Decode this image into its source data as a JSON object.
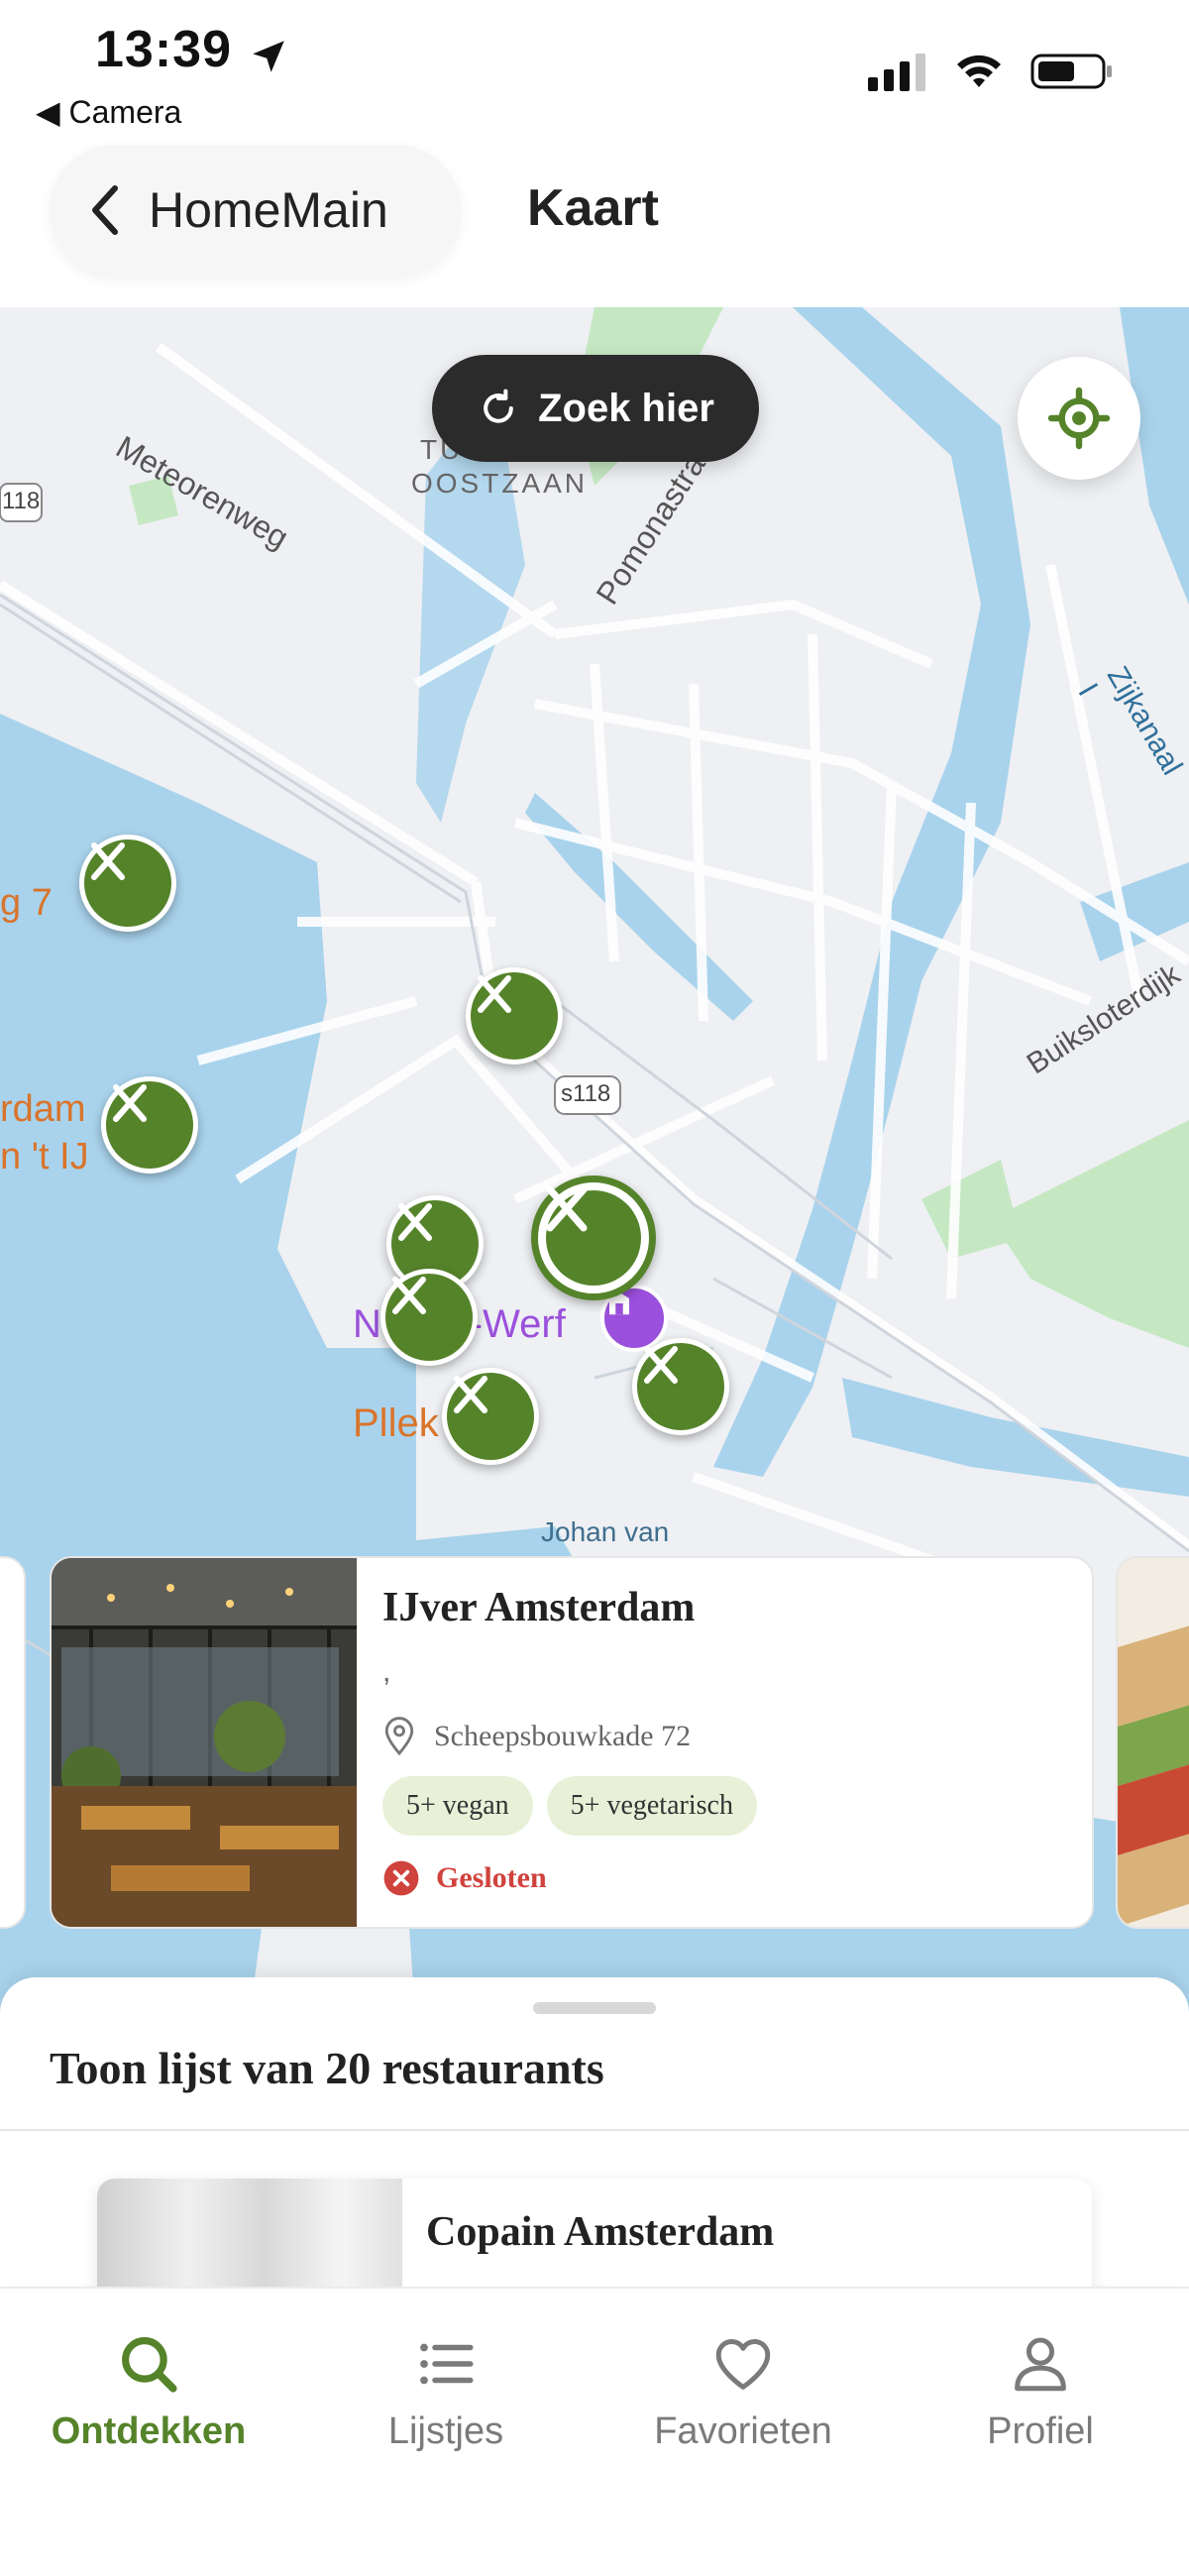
{
  "status_bar": {
    "time": "13:39",
    "back_app": "◀ Camera"
  },
  "header": {
    "back_label": "HomeMain",
    "title": "Kaart"
  },
  "map": {
    "search_here_label": "Zoek hier",
    "street_labels": [
      "Meteorenweg",
      "Pomonastraat",
      "Zijkanaal I",
      "Buiksloterdijk",
      "s118",
      "118",
      "OOSTZAAN",
      "TU",
      "Johan van"
    ],
    "poi_labels": [
      "NDSM-Werf",
      "Pllek",
      "rdam",
      "n 't IJ",
      "g 7"
    ],
    "colors": {
      "water": "#a9d3ec",
      "land": "#eef0f3",
      "park": "#c5e8c3",
      "pin": "#55832a",
      "poi_orange": "#d9742c",
      "poi_purple": "#9a50dc"
    }
  },
  "card": {
    "title": "IJver Amsterdam",
    "subtitle": ",",
    "address": "Scheepsbouwkade 72",
    "badges": [
      "5+ vegan",
      "5+ vegetarisch"
    ],
    "status": "Gesloten"
  },
  "sheet": {
    "title": "Toon lijst van 20 restaurants",
    "first_item": "Copain Amsterdam"
  },
  "tabs": [
    {
      "label": "Ontdekken",
      "icon": "search-icon",
      "active": true
    },
    {
      "label": "Lijstjes",
      "icon": "list-icon",
      "active": false
    },
    {
      "label": "Favorieten",
      "icon": "heart-icon",
      "active": false
    },
    {
      "label": "Profiel",
      "icon": "person-icon",
      "active": false
    }
  ]
}
